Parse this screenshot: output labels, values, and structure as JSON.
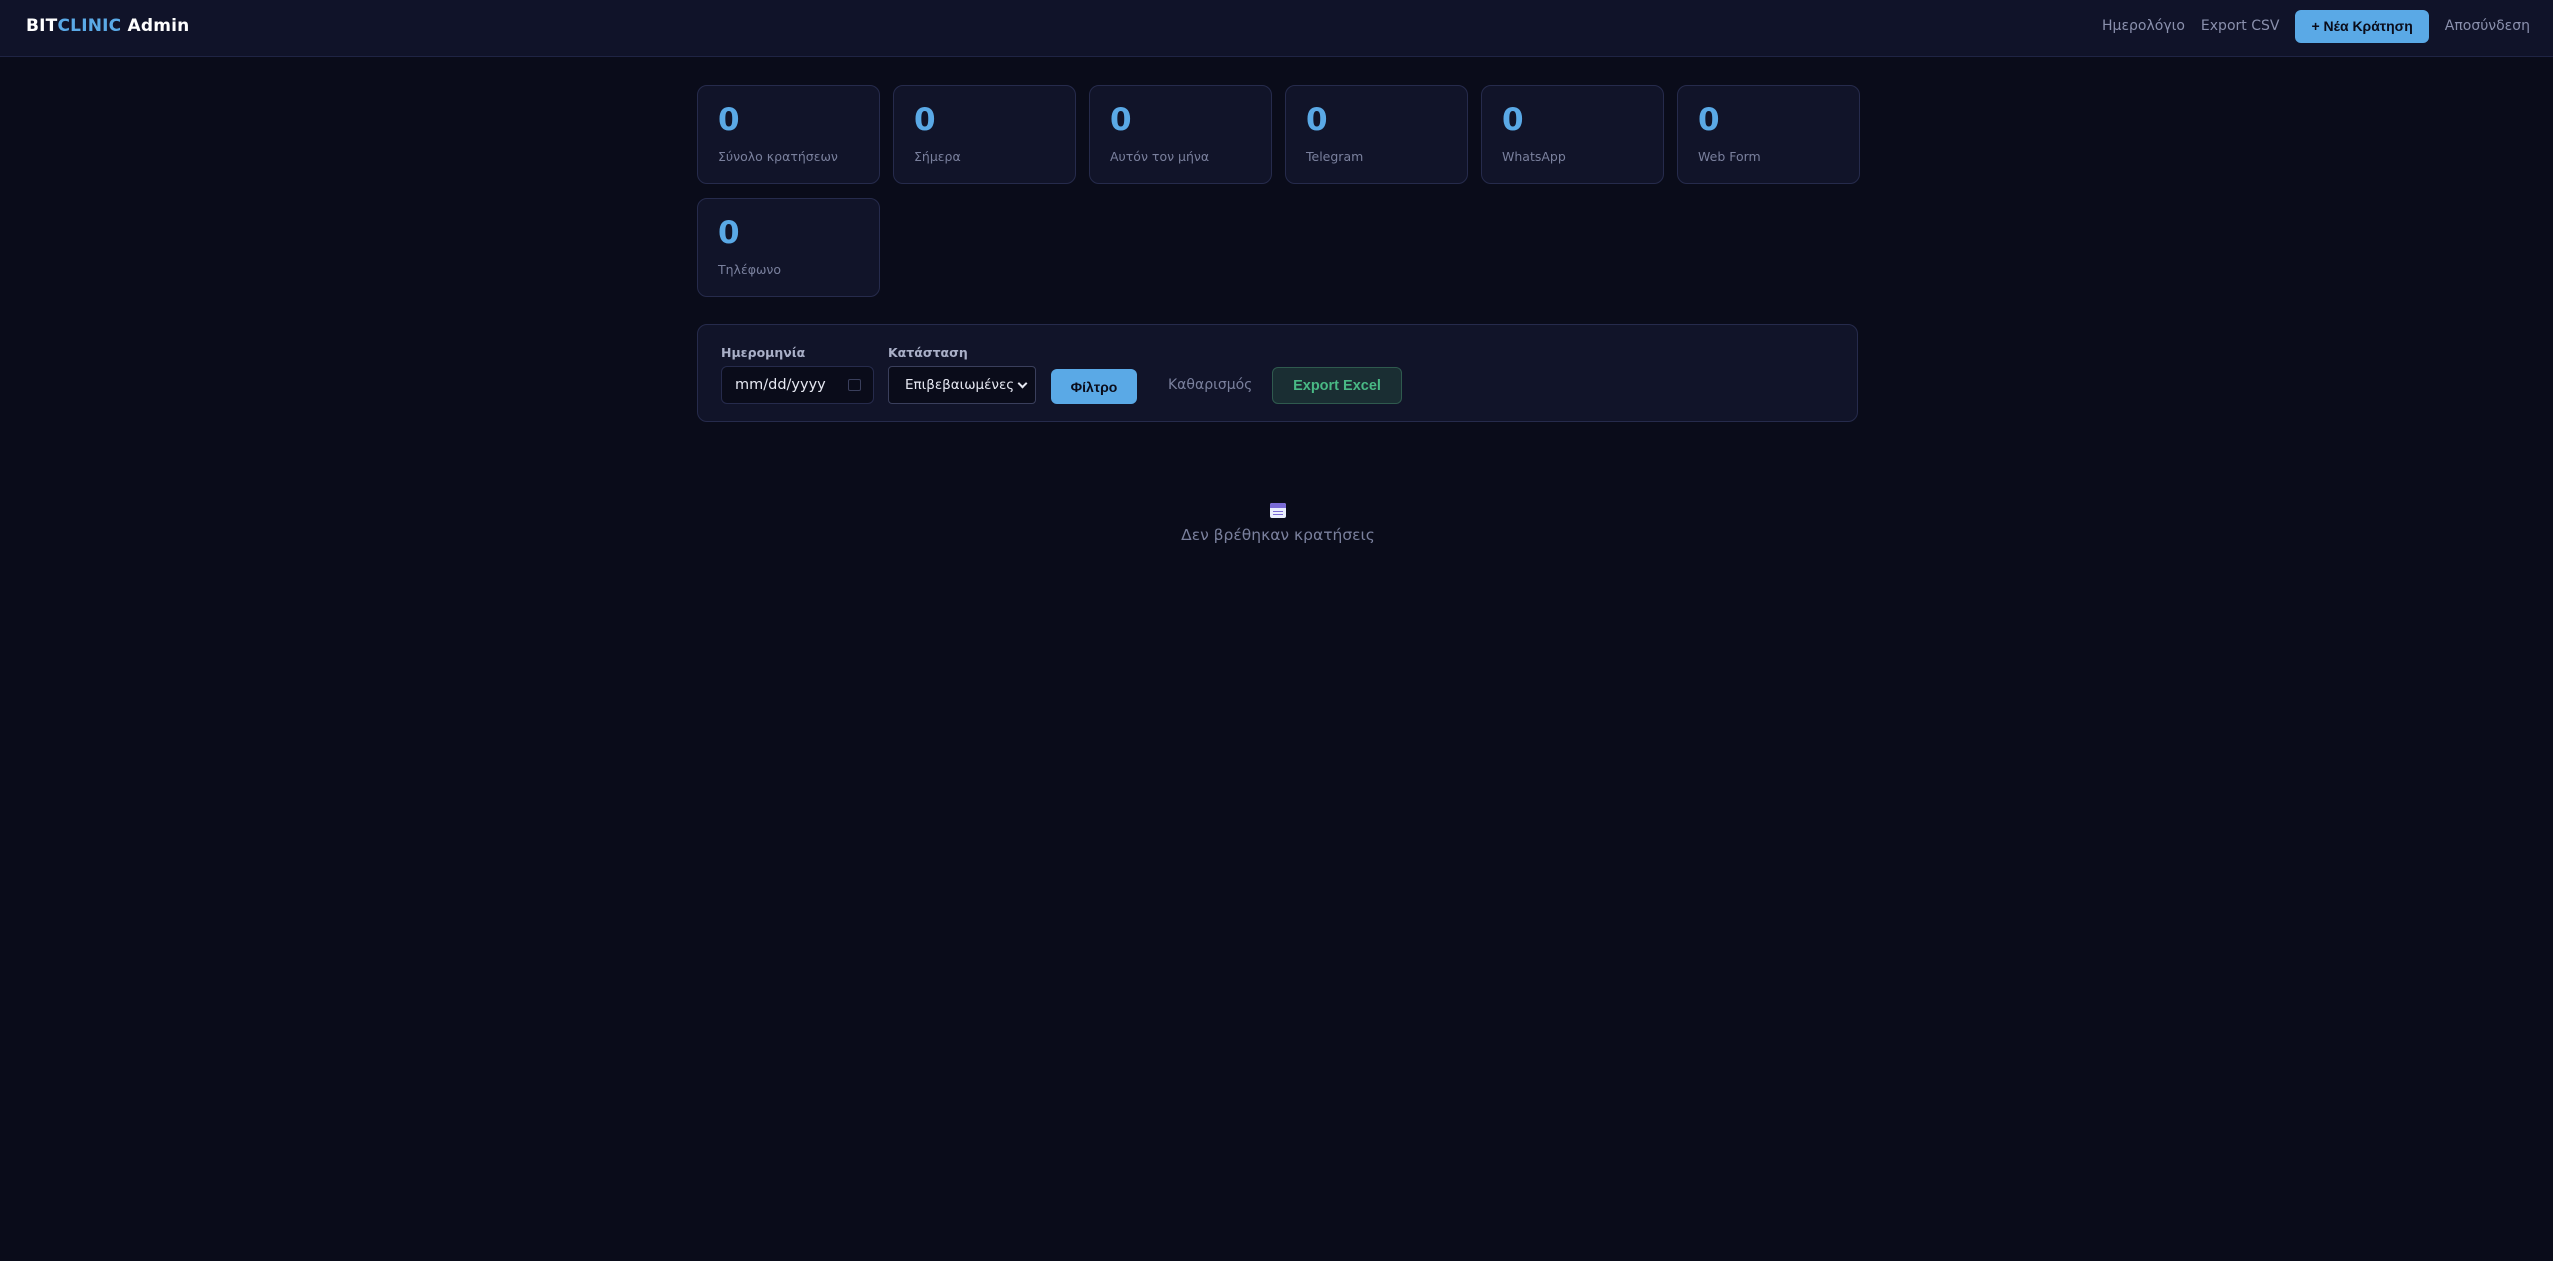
{
  "brand": {
    "part1": "BIT",
    "part2": "CLINIC",
    "part3": " Admin"
  },
  "nav": {
    "calendar": "Ημερολόγιο",
    "export_csv": "Export CSV",
    "new_booking": "+ Νέα Κράτηση",
    "logout": "Αποσύνδεση"
  },
  "stats": [
    {
      "value": "0",
      "label": "Σύνολο κρατήσεων"
    },
    {
      "value": "0",
      "label": "Σήμερα"
    },
    {
      "value": "0",
      "label": "Αυτόν τον μήνα"
    },
    {
      "value": "0",
      "label": "Telegram"
    },
    {
      "value": "0",
      "label": "WhatsApp"
    },
    {
      "value": "0",
      "label": "Web Form"
    },
    {
      "value": "0",
      "label": "Τηλέφωνο"
    }
  ],
  "filters": {
    "date_label": "Ημερομηνία",
    "date_placeholder": "mm/dd/yyyy",
    "status_label": "Κατάσταση",
    "status_value": "Επιβεβαιωμένες",
    "filter_button": "Φίλτρο",
    "clear": "Καθαρισμός",
    "export_excel": "Export Excel"
  },
  "empty_state": {
    "message": "Δεν βρέθηκαν κρατήσεις",
    "icon": "calendar-icon"
  },
  "colors": {
    "accent": "#5aa9e6",
    "background": "#0a0c1a",
    "panel": "#111429",
    "excel_green": "#49b985"
  }
}
